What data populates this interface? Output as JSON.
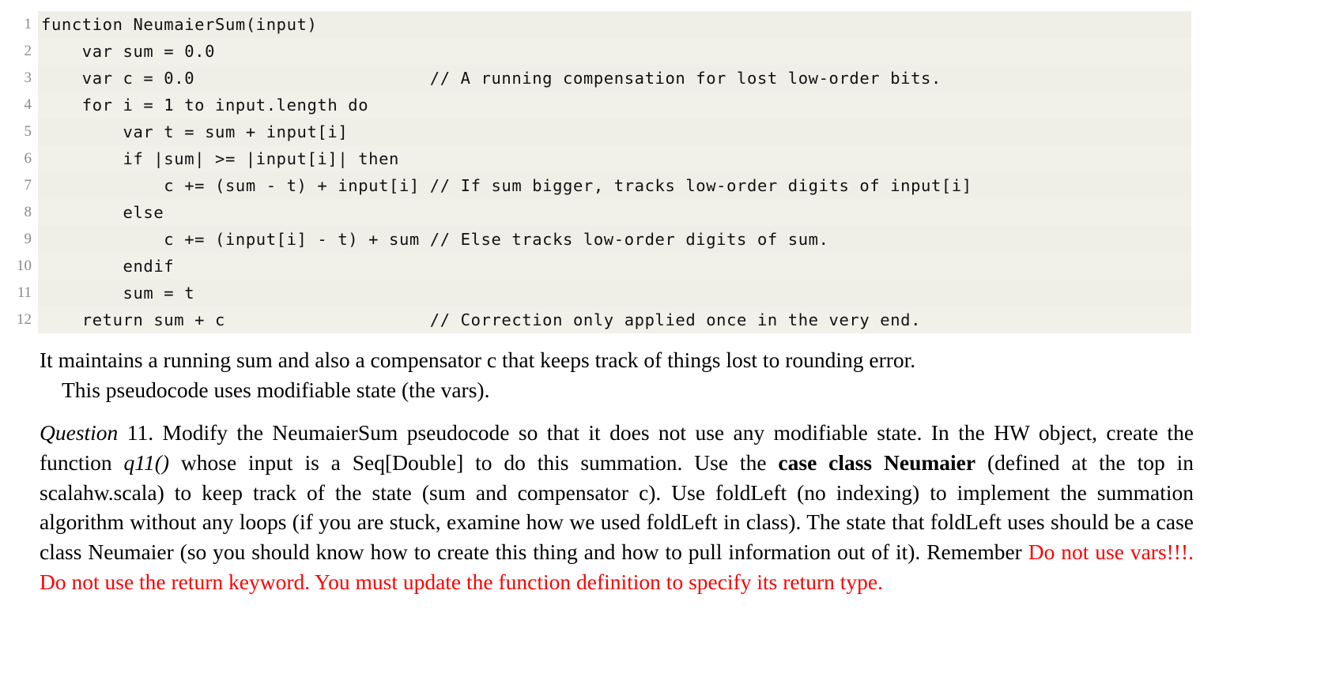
{
  "code_listing": {
    "language": "pseudocode",
    "lines": [
      {
        "number": "1",
        "text": "function NeumaierSum(input)"
      },
      {
        "number": "2",
        "text": "    var sum = 0.0"
      },
      {
        "number": "3",
        "text": "    var c = 0.0                       // A running compensation for lost low-order bits."
      },
      {
        "number": "4",
        "text": "    for i = 1 to input.length do"
      },
      {
        "number": "5",
        "text": "        var t = sum + input[i]"
      },
      {
        "number": "6",
        "text": "        if |sum| >= |input[i]| then"
      },
      {
        "number": "7",
        "text": "            c += (sum - t) + input[i] // If sum bigger, tracks low-order digits of input[i]"
      },
      {
        "number": "8",
        "text": "        else"
      },
      {
        "number": "9",
        "text": "            c += (input[i] - t) + sum // Else tracks low-order digits of sum."
      },
      {
        "number": "10",
        "text": "        endif"
      },
      {
        "number": "11",
        "text": "        sum = t"
      },
      {
        "number": "12",
        "text": "    return sum + c                    // Correction only applied once in the very end."
      }
    ]
  },
  "intro_paragraph": {
    "line1": "It maintains a running sum and also a compensator c that keeps track of things lost to rounding error.",
    "line2": "This pseudocode uses modifiable state (the vars)."
  },
  "question": {
    "label": "Question",
    "number": "11.",
    "text_1": "Modify the NeumaierSum pseudocode so that it does not use any modifiable state. In the HW object, create the function ",
    "fn_name": "q11()",
    "text_2": " whose input is a Seq[Double] to do this summation. Use the ",
    "bold_1": "case class Neumaier",
    "text_3": " (defined at the top in scalahw.scala) to keep track of the state (sum and compensator c). Use foldLeft (no indexing) to implement the summation algorithm without any loops (if you are stuck, examine how we used foldLeft in class). The state that foldLeft uses should be a case class Neumaier (so you should know how to create this thing and how to pull information out of it). Remember ",
    "warning_1": "Do not use vars!!!.",
    "warning_2": " Do not use the return keyword. You must update the function definition to specify its return type."
  },
  "colors": {
    "code_background": "#efefe7",
    "gutter_text": "#8a8a8a",
    "warning_text": "#ff0000",
    "body_text": "#000000"
  }
}
